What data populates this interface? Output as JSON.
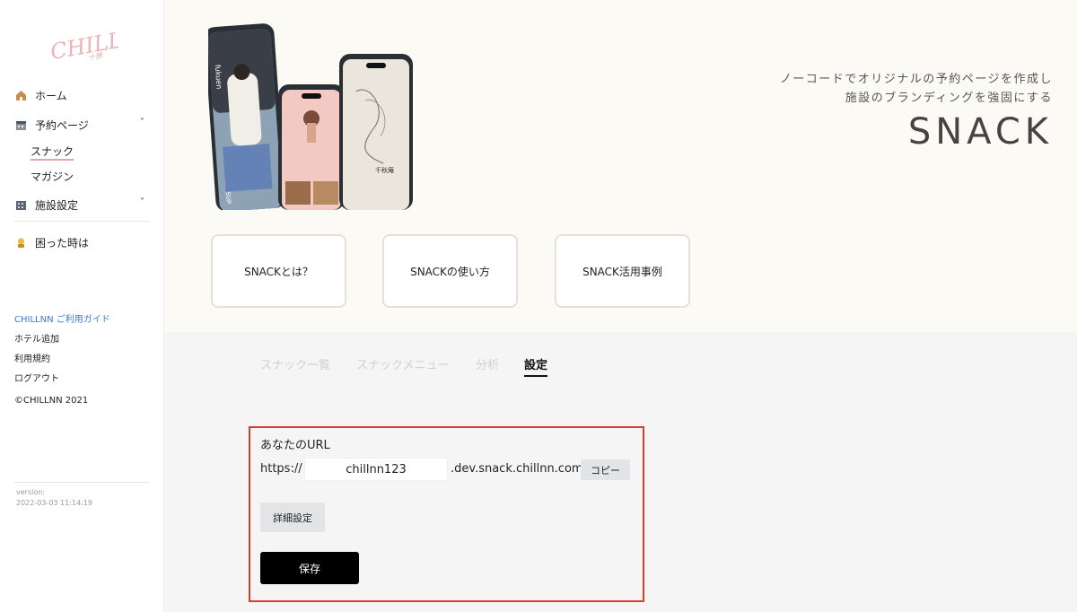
{
  "sidebar": {
    "logo_text": "CHILLNN",
    "items": [
      {
        "label": "ホーム",
        "icon": "home-icon"
      },
      {
        "label": "予約ページ",
        "icon": "calendar-icon",
        "chevron": "˄"
      },
      {
        "label": "施設設定",
        "icon": "building-icon",
        "chevron": "˅"
      },
      {
        "label": "困った時は",
        "icon": "help-icon"
      }
    ],
    "sub_items": [
      "スナック",
      "マガジン"
    ],
    "guide_link": "CHILLNN ご利用ガイド",
    "links": [
      "ホテル追加",
      "利用規約",
      "ログアウト"
    ],
    "copyright": "©CHILLNN 2021",
    "version_label": "version:",
    "version_value": "2022-03-03 11:14:19"
  },
  "hero": {
    "tagline_line1": "ノーコードでオリジナルの予約ページを作成し",
    "tagline_line2": "施設のブランディングを強固にする",
    "title": "SNACK",
    "cards": [
      "SNACKとは？",
      "SNACKの使い方",
      "SNACK活用事例"
    ]
  },
  "tabs": [
    "スナック一覧",
    "スナックメニュー",
    "分析",
    "設定"
  ],
  "active_tab": "設定",
  "settings": {
    "url_label": "あなたのURL",
    "prefix": "https://",
    "subdomain": "chillnn123",
    "domain_suffix": ".dev.snack.chillnn.com",
    "copy_label": "コピー",
    "detail_label": "詳細設定",
    "save_label": "保存"
  },
  "colors": {
    "accent_pink": "#e8a3aa",
    "link_blue": "#3b78d8",
    "highlight_red": "#e03a2f",
    "hero_bg": "#fcfaf5"
  }
}
